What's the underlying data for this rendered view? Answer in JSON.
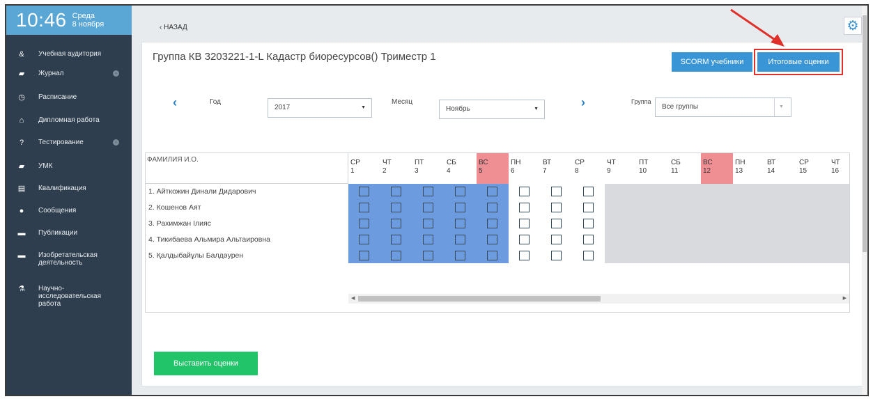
{
  "clock": {
    "time": "10:46",
    "weekday": "Среда",
    "date": "8 ноября"
  },
  "sidebar": {
    "items": [
      {
        "label": "Учебная аудитория",
        "icon": "users-icon",
        "glyph": "&"
      },
      {
        "label": "Журнал",
        "icon": "book-icon",
        "glyph": "▰",
        "has_arrow": true
      },
      {
        "label": "Расписание",
        "icon": "clock-icon",
        "glyph": "◷"
      },
      {
        "label": "Дипломная работа",
        "icon": "graduation-cap-icon",
        "glyph": "⌂"
      },
      {
        "label": "Тестирование",
        "icon": "question-icon",
        "glyph": "?",
        "has_arrow": true
      },
      {
        "label": "УМК",
        "icon": "book-icon",
        "glyph": "▰"
      },
      {
        "label": "Квалификация",
        "icon": "certificate-icon",
        "glyph": "▤"
      },
      {
        "label": "Сообщения",
        "icon": "chat-icon",
        "glyph": "●"
      },
      {
        "label": "Публикации",
        "icon": "folder-icon",
        "glyph": "▬"
      },
      {
        "label": "Изобретательская деятельность",
        "icon": "folder-open-icon",
        "glyph": "▬"
      },
      {
        "label": "Научно-исследовательская работа",
        "icon": "flask-icon",
        "glyph": "⚗"
      }
    ]
  },
  "header": {
    "back_label": "НАЗАД"
  },
  "page": {
    "title": "Группа КВ 3203221-1-L Кадастр биоресурсов() Триместр 1",
    "scorm_button": "SCORM учебники",
    "final_grades_button": "Итоговые оценки",
    "submit_button": "Выставить оценки"
  },
  "filters": {
    "year_label": "Год",
    "year_value": "2017",
    "month_label": "Месяц",
    "month_value": "Ноябрь",
    "group_label": "Группа",
    "group_value": "Все группы"
  },
  "table": {
    "name_header": "ФАМИЛИЯ И.О.",
    "days": [
      {
        "dow": "СР",
        "num": "1"
      },
      {
        "dow": "ЧТ",
        "num": "2"
      },
      {
        "dow": "ПТ",
        "num": "3"
      },
      {
        "dow": "СБ",
        "num": "4"
      },
      {
        "dow": "ВС",
        "num": "5",
        "weekend": true
      },
      {
        "dow": "ПН",
        "num": "6"
      },
      {
        "dow": "ВТ",
        "num": "7"
      },
      {
        "dow": "СР",
        "num": "8"
      },
      {
        "dow": "ЧТ",
        "num": "9"
      },
      {
        "dow": "ПТ",
        "num": "10"
      },
      {
        "dow": "СБ",
        "num": "11"
      },
      {
        "dow": "ВС",
        "num": "12",
        "weekend": true
      },
      {
        "dow": "ПН",
        "num": "13"
      },
      {
        "dow": "ВТ",
        "num": "14"
      },
      {
        "dow": "СР",
        "num": "15"
      },
      {
        "dow": "ЧТ",
        "num": "16"
      }
    ],
    "students": [
      "1. Айткожин Динали Дидарович",
      "2. Кошенов Аят",
      "3. Рахимжан Ілияс",
      "4. Тикибаева Альмира Альтаировна",
      "5. Қалдыбайұлы Балдәурен"
    ]
  },
  "colors": {
    "accent": "#3a95d6",
    "sidebar": "#2e3e4e",
    "highlight": "#e0302a",
    "weekend": "#f08f93",
    "submit": "#22c46a"
  }
}
